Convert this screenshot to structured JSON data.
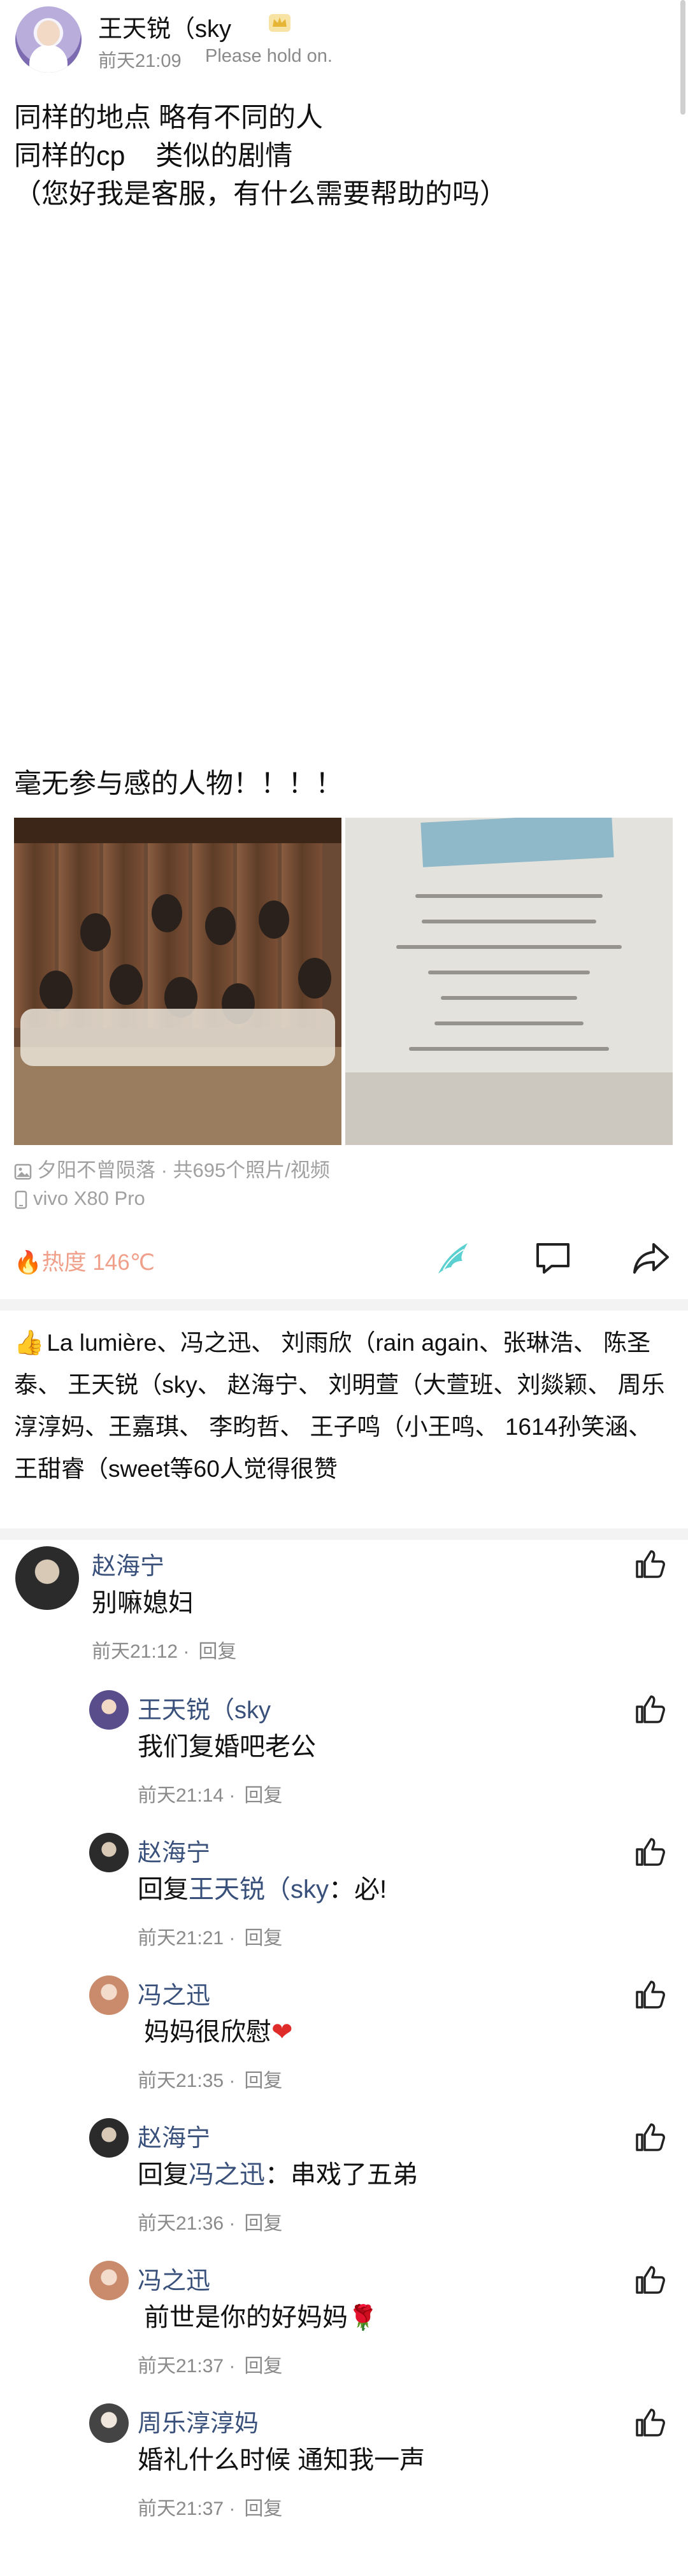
{
  "post": {
    "author": "王天锐（sky",
    "time": "前天21:09",
    "tagline": "Please hold on.",
    "lines": [
      "同样的地点 略有不同的人",
      "同样的cp    类似的剧情",
      "（您好我是客服，有什么需要帮助的吗）",
      "毫无参与感的人物！！！！"
    ],
    "album": "夕阳不曾陨落 · 共695个照片/视频",
    "device": "vivo X80 Pro",
    "heat": "热度 146℃"
  },
  "likes": {
    "text": "La lumière、冯之迅、   刘雨欣（rain again、张琳浩、 陈圣泰、  王天锐（sky、  赵海宁、  刘明萱（大萱班、刘燚颖、  周乐淳淳妈、王嘉琪、  李昀哲、  王子鸣（小王鸣、   1614孙笑涵、  王甜睿（sweet等60人觉得很赞"
  },
  "colors": {
    "link": "#39507a",
    "time": "#8a8a8a",
    "heat": "#f0a08a"
  },
  "comments": [
    {
      "name": "赵海宁",
      "text": "别嘛媳妇",
      "time": "前天21:12",
      "reply": "回复"
    },
    {
      "name": "王天锐（sky",
      "text": "我们复婚吧老公",
      "time": "前天21:14",
      "reply": "回复"
    },
    {
      "name": "赵海宁",
      "text_prefix": "回复",
      "text_link": "王天锐（sky",
      "text_suffix": "：必!",
      "time": "前天21:21",
      "reply": "回复"
    },
    {
      "name": "冯之迅",
      "text": "妈妈很欣慰",
      "time": "前天21:35",
      "reply": "回复"
    },
    {
      "name": "赵海宁",
      "text_prefix": "回复",
      "text_link": "冯之迅",
      "text_suffix": "：串戏了五弟",
      "time": "前天21:36",
      "reply": "回复"
    },
    {
      "name": "冯之迅",
      "text": "前世是你的好妈妈",
      "time": "前天21:37",
      "reply": "回复"
    },
    {
      "name": "周乐淳淳妈",
      "text": "婚礼什么时候 通知我一声",
      "time": "前天21:37",
      "reply": "回复"
    }
  ]
}
